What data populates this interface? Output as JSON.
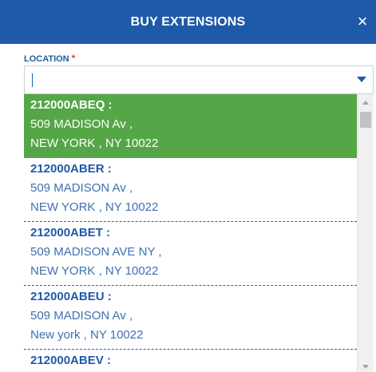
{
  "header": {
    "title": "BUY EXTENSIONS",
    "close_icon": "×"
  },
  "location": {
    "label": "LOCATION",
    "required_marker": "*",
    "value": ""
  },
  "options": [
    {
      "code": "212000ABEQ :",
      "line1": "509 MADISON Av ,",
      "line2": "NEW YORK , NY 10022",
      "selected": true
    },
    {
      "code": "212000ABER :",
      "line1": "509 MADISON Av ,",
      "line2": "NEW YORK , NY 10022",
      "selected": false
    },
    {
      "code": "212000ABET :",
      "line1": "509 MADISON AVE NY ,",
      "line2": "NEW YORK , NY 10022",
      "selected": false
    },
    {
      "code": "212000ABEU :",
      "line1": "509 MADISON Av ,",
      "line2": "New york , NY 10022",
      "selected": false
    },
    {
      "code": "212000ABEV :",
      "selected": false
    }
  ],
  "colors": {
    "header_bg": "#1f5aa8",
    "selected_bg": "#55a647",
    "link_text": "#3f6fb0",
    "required": "#e23b3b"
  }
}
